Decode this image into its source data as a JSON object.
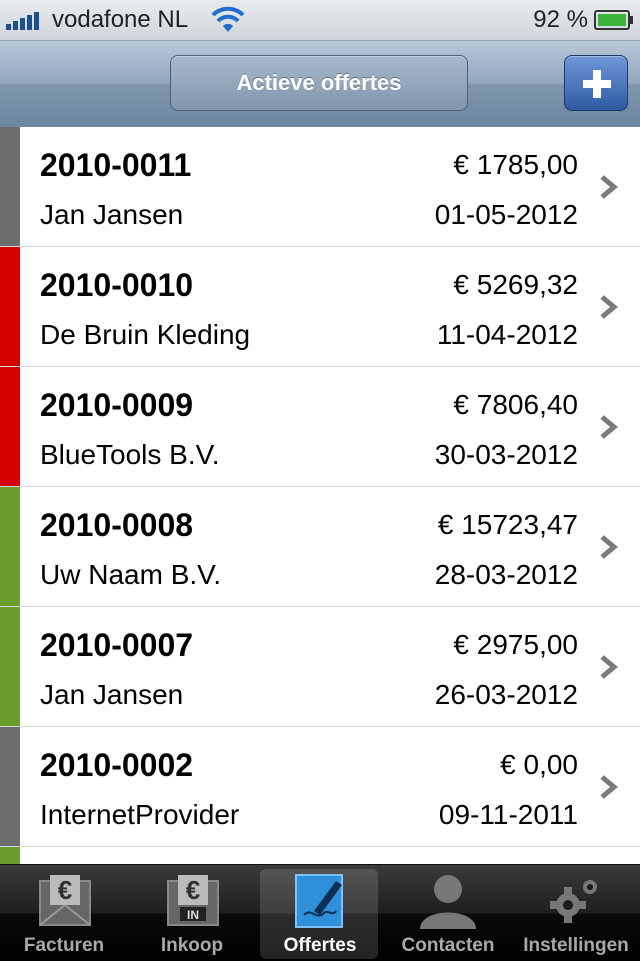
{
  "status_bar": {
    "carrier": "vodafone NL",
    "battery": "92 %"
  },
  "nav": {
    "title": "Actieve offertes",
    "add_label": "+"
  },
  "colors": {
    "gray": "#6d6d6d",
    "red": "#d40000",
    "green": "#6b9d2c"
  },
  "rows": [
    {
      "number": "2010-0011",
      "client": "Jan Jansen",
      "amount": "€ 1785,00",
      "date": "01-05-2012",
      "status": "gray"
    },
    {
      "number": "2010-0010",
      "client": "De Bruin Kleding",
      "amount": "€ 5269,32",
      "date": "11-04-2012",
      "status": "red"
    },
    {
      "number": "2010-0009",
      "client": "BlueTools B.V.",
      "amount": "€ 7806,40",
      "date": "30-03-2012",
      "status": "red"
    },
    {
      "number": "2010-0008",
      "client": "Uw Naam B.V.",
      "amount": "€ 15723,47",
      "date": "28-03-2012",
      "status": "green"
    },
    {
      "number": "2010-0007",
      "client": "Jan Jansen",
      "amount": "€ 2975,00",
      "date": "26-03-2012",
      "status": "green"
    },
    {
      "number": "2010-0002",
      "client": "InternetProvider",
      "amount": "€ 0,00",
      "date": "09-11-2011",
      "status": "gray"
    },
    {
      "number": "",
      "client": "",
      "amount": "",
      "date": "",
      "status": "green"
    }
  ],
  "tabs": [
    {
      "label": "Facturen",
      "icon": "invoice-envelope-icon"
    },
    {
      "label": "Inkoop",
      "icon": "purchase-envelope-icon",
      "badge": "IN"
    },
    {
      "label": "Offertes",
      "icon": "quote-pen-icon"
    },
    {
      "label": "Contacten",
      "icon": "person-icon"
    },
    {
      "label": "Instellingen",
      "icon": "gears-icon"
    }
  ]
}
